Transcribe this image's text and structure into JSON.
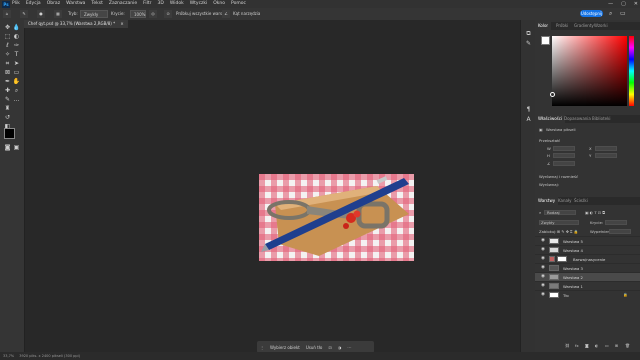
{
  "app": {
    "logo": "Ps"
  },
  "menu": [
    "Plik",
    "Edycja",
    "Obraz",
    "Warstwa",
    "Tekst",
    "Zaznaczanie",
    "Filtr",
    "3D",
    "Widok",
    "Wtyczki",
    "Okno",
    "Pomoc"
  ],
  "window_controls": {
    "minimize": "—",
    "maximize": "▢",
    "close": "✕"
  },
  "options_bar": {
    "mode_label": "Tryb:",
    "mode_value": "Zwykły",
    "opacity_label": "Krycie:",
    "opacity_value": "100%",
    "flow_label": "Przepływ:",
    "flow_value": "100%",
    "sample_all_layers": "Próbkuj wszystkie warstwy",
    "pressure_label": "Kąt narzędzia",
    "share_label": "Udostępnij"
  },
  "document_tab": {
    "title": "Chef qyt.psd @ 33,7% (Warstwa 2,RGB/8) *",
    "close": "×"
  },
  "toolbar_icons": [
    "move-icon",
    "marquee-icon",
    "lasso-icon",
    "quick-select-icon",
    "crop-icon",
    "frame-icon",
    "eyedropper-icon",
    "healing-icon",
    "brush-icon",
    "stamp-icon",
    "history-brush-icon",
    "eraser-icon",
    "gradient-icon",
    "blur-icon",
    "dodge-icon",
    "pen-icon",
    "type-icon",
    "path-select-icon",
    "rectangle-icon",
    "hand-icon",
    "zoom-icon",
    "more-icon",
    "color-swatch",
    "quick-mask-icon",
    "screen-mode-icon"
  ],
  "color_panel": {
    "tabs": [
      "Kolor",
      "Próbki",
      "Gradienty",
      "Wzorki"
    ],
    "hue_color": "#ff0000"
  },
  "properties_panel": {
    "tabs": [
      "Właściwości",
      "Dopasowania",
      "Biblioteki"
    ],
    "layer_kind": "Warstwa pikseli",
    "section_transform": "Przekształć",
    "field_w": "W",
    "field_h": "H",
    "field_x": "X",
    "field_y": "Y",
    "angle": "0,00°",
    "section_align": "Wyrównaj i rozmieść",
    "align_label": "Wyrównaj:"
  },
  "layers_panel": {
    "tabs": [
      "Warstwy",
      "Kanały",
      "Ścieżki"
    ],
    "filter_label": "Rodzaj",
    "blend_mode": "Zwykły",
    "opacity_label": "Krycie:",
    "opacity_value": "100%",
    "lock_label": "Zablokuj:",
    "fill_label": "Wypełnienie:",
    "fill_value": "100%",
    "layers": [
      {
        "name": "Warstwa 5",
        "visible": true,
        "selected": false
      },
      {
        "name": "Warstwa 4",
        "visible": true,
        "selected": false
      },
      {
        "name": "Barwa/nasycenie",
        "visible": true,
        "selected": false
      },
      {
        "name": "Warstwa 3",
        "visible": true,
        "selected": false
      },
      {
        "name": "Warstwa 2",
        "visible": true,
        "selected": true
      },
      {
        "name": "Warstwa 1",
        "visible": true,
        "selected": false
      },
      {
        "name": "Tło",
        "visible": true,
        "selected": false
      }
    ]
  },
  "contextual_bar": {
    "select_subject": "Wybierz obiekt",
    "remove_bg": "Usuń tło"
  },
  "status_bar": {
    "zoom": "33,7%",
    "info": "3920 piks. x 2400 pikseli (300 ppi)"
  },
  "colors": {
    "accent": "#1473e6",
    "foreground": "#000000",
    "background": "#ffffff"
  }
}
